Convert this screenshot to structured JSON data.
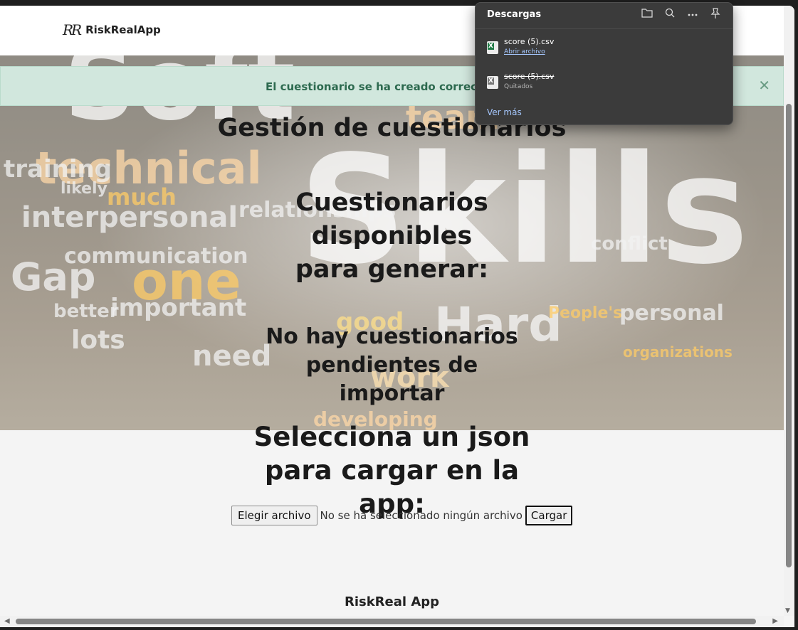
{
  "navbar": {
    "logo": "RR",
    "app_name": "RiskRealApp"
  },
  "hero": {
    "background_words": [
      "Soft",
      "Skills",
      "technical",
      "interpersonal",
      "communication",
      "Gap",
      "one",
      "important",
      "Hard",
      "People's",
      "personal",
      "organizations",
      "developing",
      "work",
      "team",
      "conflict",
      "much",
      "likely",
      "training",
      "relationships",
      "lots",
      "good",
      "need",
      "better"
    ]
  },
  "alert": {
    "message": "El cuestionario se ha creado correctamente",
    "close_glyph": "✕"
  },
  "main": {
    "title": "Gestión de cuestionarios",
    "available_heading": "Cuestionarios disponibles para generar:",
    "pending_heading": "No hay cuestionarios pendientes de importar",
    "select_heading": "Selecciona un json para cargar en la app:"
  },
  "upload": {
    "choose_button": "Elegir archivo",
    "file_status": "No se ha seleccionado ningún archivo",
    "load_button": "Cargar"
  },
  "footer": {
    "text": "RiskReal App"
  },
  "downloads": {
    "title": "Descargas",
    "items": [
      {
        "name": "score (5).csv",
        "action": "Abrir archivo",
        "removed": false
      },
      {
        "name": "score (5).csv",
        "status": "Quitados",
        "removed": true
      }
    ],
    "see_more": "Ver más"
  }
}
